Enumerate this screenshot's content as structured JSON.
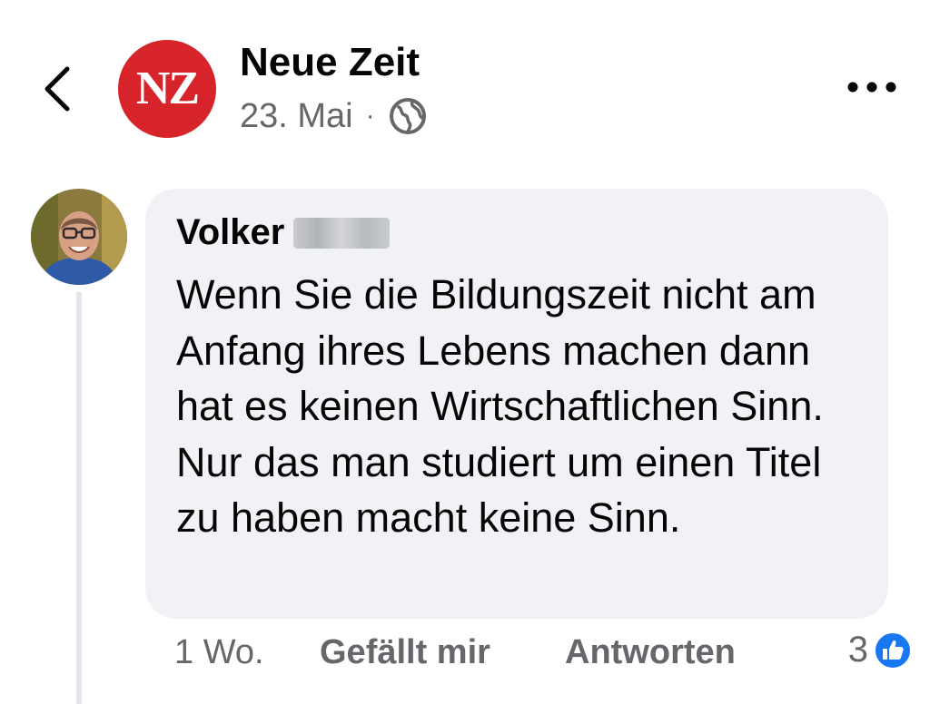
{
  "header": {
    "page_name": "Neue Zeit",
    "page_logo_text": "NZ",
    "date": "23. Mai",
    "separator": "·",
    "audience_icon": "globe-icon",
    "back_icon": "chevron-left-icon",
    "more_icon": "more-horizontal-icon"
  },
  "comment": {
    "author": "Volker",
    "author_surname_redacted": true,
    "text": "Wenn Sie die Bildungszeit nicht am Anfang ihres Lebens machen dann hat es keinen Wirtschaftlichen Sinn. Nur das man studiert um einen Titel zu haben macht keine Sinn.",
    "timestamp": "1 Wo.",
    "like_label": "Gefällt mir",
    "reply_label": "Antworten",
    "reaction_count": "3",
    "reaction_icon": "thumbs-up-icon"
  },
  "colors": {
    "logo_red": "#d7242b",
    "bubble_bg": "#f0f2f5",
    "secondary_text": "#65676b",
    "like_blue": "#1877f2"
  }
}
